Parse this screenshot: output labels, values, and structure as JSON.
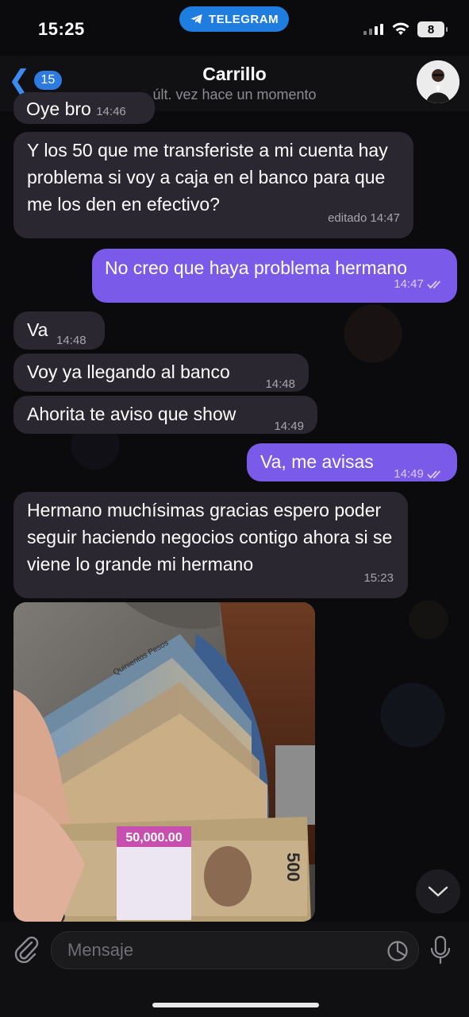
{
  "status_bar": {
    "time": "15:25",
    "app_pill": "TELEGRAM",
    "battery": "8"
  },
  "header": {
    "back_count": "15",
    "title": "Carrillo",
    "subtitle": "últ. vez hace un momento"
  },
  "messages": [
    {
      "dir": "in",
      "text": "Oye bro",
      "time": "14:46"
    },
    {
      "dir": "in",
      "text": "Y  los 50 que me transferiste a mi cuenta hay problema si voy a caja en el banco para que me los den en efectivo?",
      "time": "editado 14:47"
    },
    {
      "dir": "out",
      "text": "No creo que haya problema hermano",
      "time": "14:47"
    },
    {
      "dir": "in",
      "text": "Va",
      "time": "14:48"
    },
    {
      "dir": "in",
      "text": "Voy ya llegando al banco",
      "time": "14:48"
    },
    {
      "dir": "in",
      "text": "Ahorita te aviso que show",
      "time": "14:49"
    },
    {
      "dir": "out",
      "text": "Va, me avisas",
      "time": "14:49"
    },
    {
      "dir": "in",
      "text": "Hermano muchísimas gracias espero poder seguir haciendo negocios contigo ahora si se viene lo grande mi hermano",
      "time": "15:23"
    }
  ],
  "photo": {
    "band_label": "50,000.00",
    "note_value": "500",
    "note_text": "Quinientos Pesos"
  },
  "input": {
    "placeholder": "Mensaje"
  },
  "colors": {
    "incoming_bubble": "#2b2730",
    "outgoing_bubble": "#7a5ae8",
    "accent": "#2d7ae0"
  }
}
